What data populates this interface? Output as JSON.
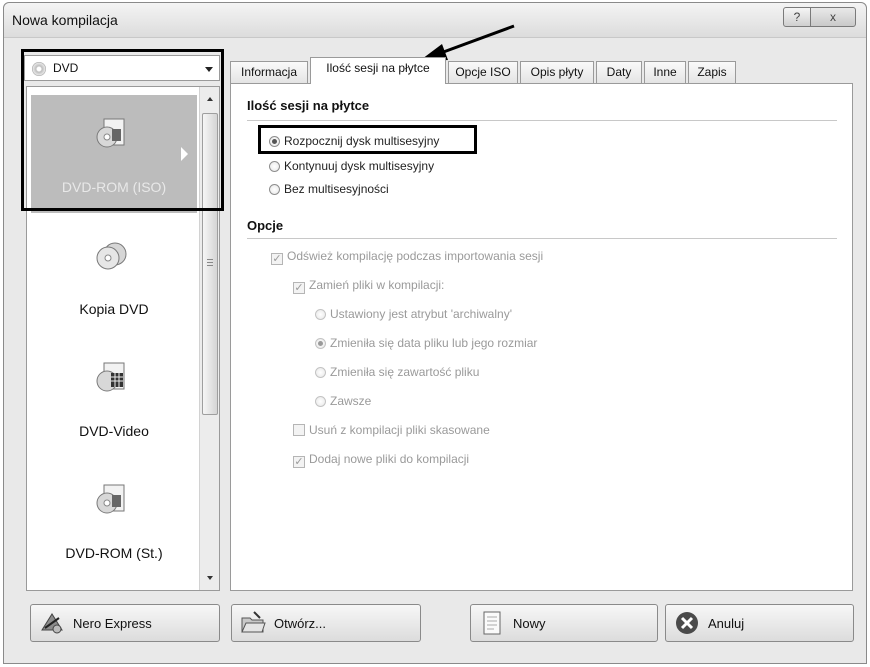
{
  "window": {
    "title": "Nowa kompilacja",
    "help_label": "?",
    "close_label": "x"
  },
  "left_panel": {
    "dropdown_value": "DVD",
    "items": [
      {
        "label": "DVD-ROM (ISO)",
        "icon": "dvd-rom-icon",
        "selected": true
      },
      {
        "label": "Kopia DVD",
        "icon": "disc-copy-icon",
        "selected": false
      },
      {
        "label": "DVD-Video",
        "icon": "dvd-video-icon",
        "selected": false
      },
      {
        "label": "DVD-ROM (St.)",
        "icon": "dvd-rom-standard-icon",
        "selected": false
      }
    ]
  },
  "tabs": [
    {
      "label": "Informacja",
      "active": false
    },
    {
      "label": "Ilość sesji na płytce",
      "active": true
    },
    {
      "label": "Opcje ISO",
      "active": false
    },
    {
      "label": "Opis płyty",
      "active": false
    },
    {
      "label": "Daty",
      "active": false
    },
    {
      "label": "Inne",
      "active": false
    },
    {
      "label": "Zapis",
      "active": false
    }
  ],
  "session": {
    "title": "Ilość sesji na płytce",
    "options": [
      {
        "label": "Rozpocznij dysk multisesyjny",
        "checked": true
      },
      {
        "label": "Kontynuuj dysk multisesyjny",
        "checked": false
      },
      {
        "label": "Bez multisesyjności",
        "checked": false
      }
    ]
  },
  "options": {
    "title": "Opcje",
    "refresh": {
      "label": "Odśwież kompilację podczas importowania sesji",
      "checked": true
    },
    "replace": {
      "label": "Zamień pliki w kompilacji:",
      "checked": true
    },
    "replace_modes": [
      {
        "label": "Ustawiony jest atrybut 'archiwalny'",
        "checked": false
      },
      {
        "label": "Zmieniła się data pliku lub jego rozmiar",
        "checked": true
      },
      {
        "label": "Zmieniła się zawartość pliku",
        "checked": false
      },
      {
        "label": "Zawsze",
        "checked": false
      }
    ],
    "remove_deleted": {
      "label": "Usuń z kompilacji pliki skasowane",
      "checked": false
    },
    "add_new": {
      "label": "Dodaj nowe pliki do kompilacji",
      "checked": true
    }
  },
  "buttons": {
    "nero_express": "Nero Express",
    "open": "Otwórz...",
    "new": "Nowy",
    "cancel": "Anuluj"
  },
  "colors": {
    "selection": "#bcbcbc",
    "highlight_border": "#000000"
  }
}
